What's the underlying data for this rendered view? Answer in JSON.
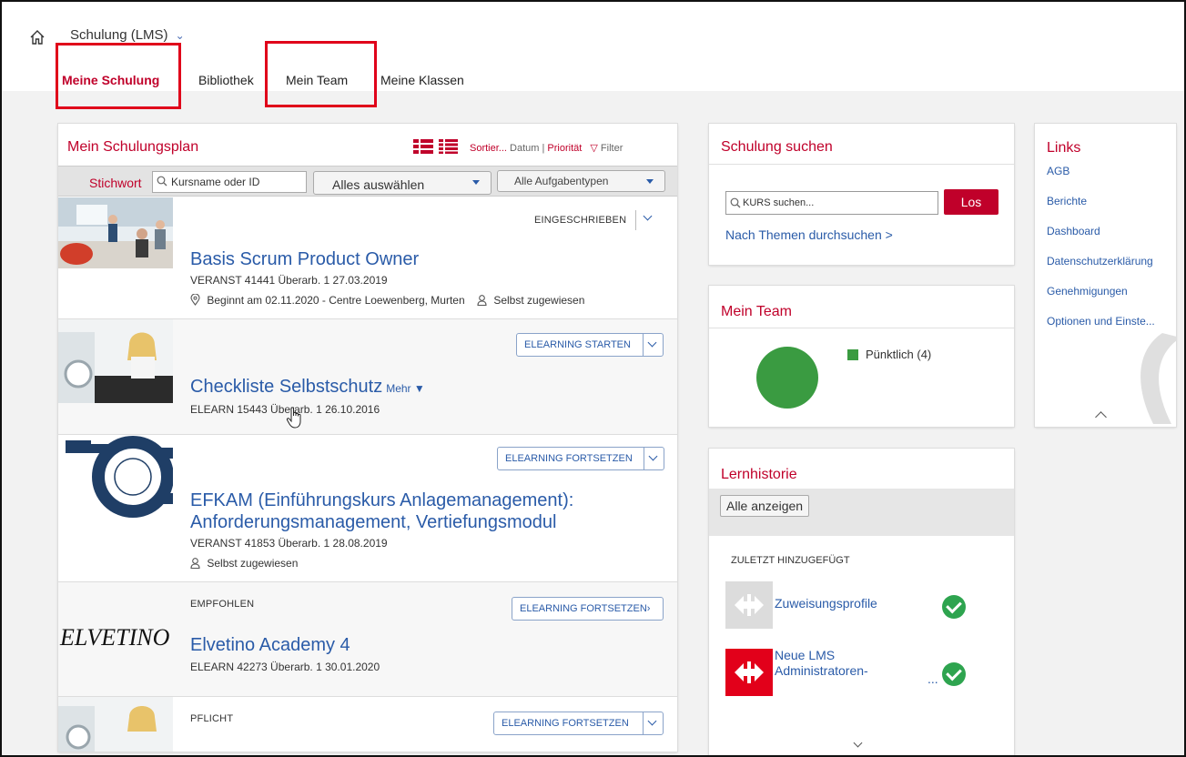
{
  "header": {
    "home_icon": "home-icon",
    "app_title": "Schulung (LMS)",
    "tabs": [
      {
        "label": "Meine Schulung",
        "active": true
      },
      {
        "label": "Bibliothek",
        "active": false
      },
      {
        "label": "Mein Team",
        "active": false
      },
      {
        "label": "Meine Klassen",
        "active": false
      }
    ]
  },
  "plan": {
    "title": "Mein Schulungsplan",
    "sort_label": "Sortier...",
    "sort_datum": "Datum",
    "sort_sep": "|",
    "sort_prioritaet": "Priorität",
    "filter_label": "Filter",
    "stichwort_label": "Stichwort",
    "search_placeholder": "Kursname oder ID",
    "select_all": "Alles auswählen",
    "task_types": "Alle Aufgabentypen",
    "courses": [
      {
        "status": "EINGESCHRIEBEN",
        "title": "Basis Scrum Product Owner",
        "meta": "VERANST 41441 Überarb. 1 27.03.2019",
        "location": "Beginnt am 02.11.2020 - Centre Loewenberg, Murten",
        "assigned": "Selbst zugewiesen"
      },
      {
        "button": "ELEARNING STARTEN",
        "title": "Checkliste Selbstschutz",
        "mehr": "Mehr ▼",
        "meta": "ELEARN 15443 Überarb. 1 26.10.2016"
      },
      {
        "button": "ELEARNING FORTSETZEN",
        "title_line1": "EFKAM (Einführungskurs Anlagemanagement):",
        "title_line2": "Anforderungsmanagement, Vertiefungsmodul",
        "meta": "VERANST 41853 Überarb. 1 28.08.2019",
        "assigned": "Selbst zugewiesen"
      },
      {
        "status": "EMPFOHLEN",
        "button": "ELEARNING FORTSETZEN",
        "logo_text": "ELVETINO",
        "title": "Elvetino Academy 4",
        "meta": "ELEARN 42273 Überarb. 1 30.01.2020"
      },
      {
        "status": "PFLICHT",
        "button": "ELEARNING FORTSETZEN"
      }
    ]
  },
  "suchen": {
    "title": "Schulung suchen",
    "placeholder": "KURS suchen...",
    "button": "Los",
    "themen": "Nach Themen durchsuchen >"
  },
  "team": {
    "title": "Mein Team",
    "legend": "Pünktlich (4)",
    "chart_data": {
      "type": "pie",
      "categories": [
        "Pünktlich"
      ],
      "values": [
        4
      ],
      "colors": [
        "#3a9b41"
      ]
    }
  },
  "history": {
    "title": "Lernhistorie",
    "show_all": "Alle anzeigen",
    "recent_label": "ZULETZT HINZUGEFÜGT",
    "items": [
      {
        "title": "Zuweisungsprofile"
      },
      {
        "title_line1": "Neue LMS",
        "title_line2": "Administratoren-",
        "ellipsis": "..."
      }
    ]
  },
  "links": {
    "title": "Links",
    "items": [
      "AGB",
      "Berichte",
      "Dashboard",
      "Datenschutzerklärung",
      "Genehmigungen",
      "Optionen und Einste..."
    ]
  },
  "colors": {
    "accent_red": "#c0002a",
    "link_blue": "#2a5ba8",
    "success_green": "#2ea44f"
  }
}
